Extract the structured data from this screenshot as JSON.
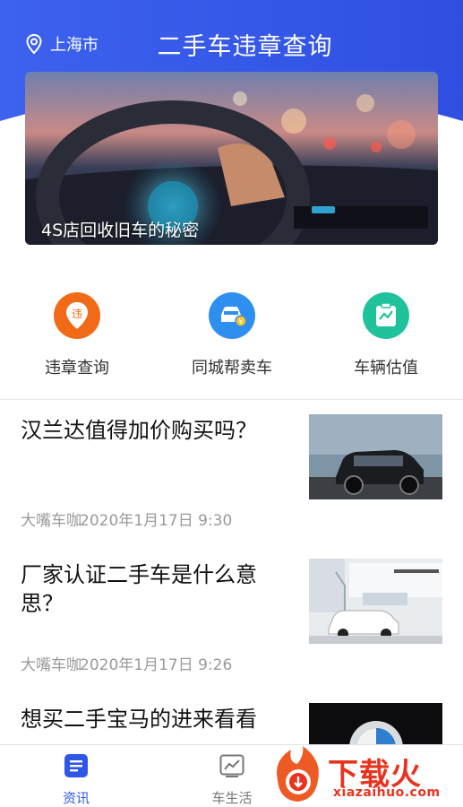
{
  "header": {
    "location": "上海市",
    "title": "二手车违章查询",
    "accent": "#2e57e8"
  },
  "banner": {
    "caption": "4S店回收旧车的秘密"
  },
  "quick_menu": [
    {
      "label": "违章查询",
      "icon": "violation-pin-icon",
      "color": "#f06a17"
    },
    {
      "label": "同城帮卖车",
      "icon": "car-sell-icon",
      "color": "#2f8ff0"
    },
    {
      "label": "车辆估值",
      "icon": "valuation-chart-icon",
      "color": "#1fc29a"
    }
  ],
  "news": [
    {
      "title": "汉兰达值得加价购买吗？",
      "source": "大嘴车咖",
      "time": "2020年1月17日 9:30"
    },
    {
      "title": "厂家认证二手车是什么意思？",
      "source": "大嘴车咖",
      "time": "2020年1月17日 9:26"
    },
    {
      "title": "想买二手宝马的进来看看",
      "source": "",
      "time": ""
    }
  ],
  "tabbar": {
    "tabs": [
      {
        "label": "资讯",
        "active": true
      },
      {
        "label": "车生活",
        "active": false
      }
    ]
  },
  "watermark": {
    "text": "下载火",
    "url": "xiazaihuo.com"
  }
}
